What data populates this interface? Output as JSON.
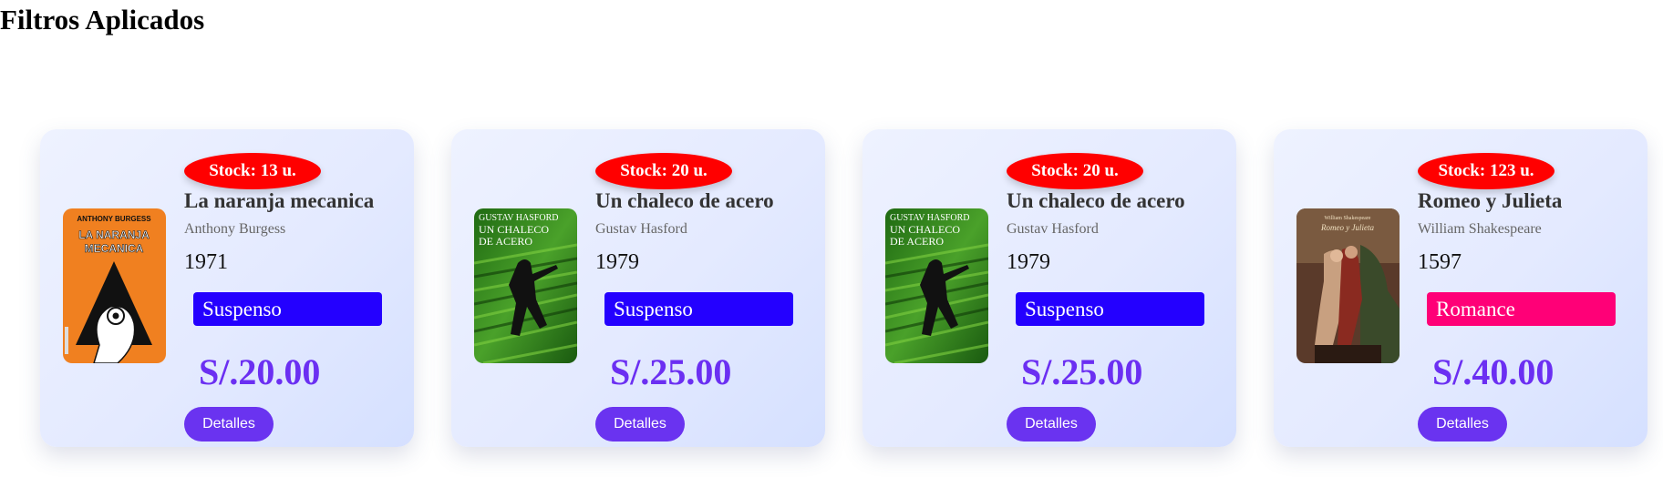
{
  "page": {
    "title": "Filtros Aplicados"
  },
  "books": [
    {
      "stock": "Stock: 13 u.",
      "title": "La naranja mecanica",
      "author": "Anthony Burgess",
      "year": "1971",
      "genre": "Suspenso",
      "genre_color": "#2400ff",
      "price": "S/.20.00",
      "button": "Detalles",
      "cover_icon": "clockwork-orange-cover",
      "cover_text": [
        "ANTHONY BURGESS",
        "LA NARANJA",
        "MECANICA"
      ]
    },
    {
      "stock": "Stock: 20 u.",
      "title": "Un chaleco de acero",
      "author": "Gustav Hasford",
      "year": "1979",
      "genre": "Suspenso",
      "genre_color": "#2400ff",
      "price": "S/.25.00",
      "button": "Detalles",
      "cover_icon": "soldier-cover",
      "cover_text": [
        "GUSTAV HASFORD",
        "UN CHALECO",
        "DE ACERO"
      ]
    },
    {
      "stock": "Stock: 20 u.",
      "title": "Un chaleco de acero",
      "author": "Gustav Hasford",
      "year": "1979",
      "genre": "Suspenso",
      "genre_color": "#2400ff",
      "price": "S/.25.00",
      "button": "Detalles",
      "cover_icon": "soldier-cover",
      "cover_text": [
        "GUSTAV HASFORD",
        "UN CHALECO",
        "DE ACERO"
      ]
    },
    {
      "stock": "Stock: 123 u.",
      "title": "Romeo y Julieta",
      "author": "William Shakespeare",
      "year": "1597",
      "genre": "Romance",
      "genre_color": "#ff0077",
      "price": "S/.40.00",
      "button": "Detalles",
      "cover_icon": "painting-cover",
      "cover_text": [
        "William Shakespeare",
        "Romeo y Julieta"
      ]
    }
  ]
}
